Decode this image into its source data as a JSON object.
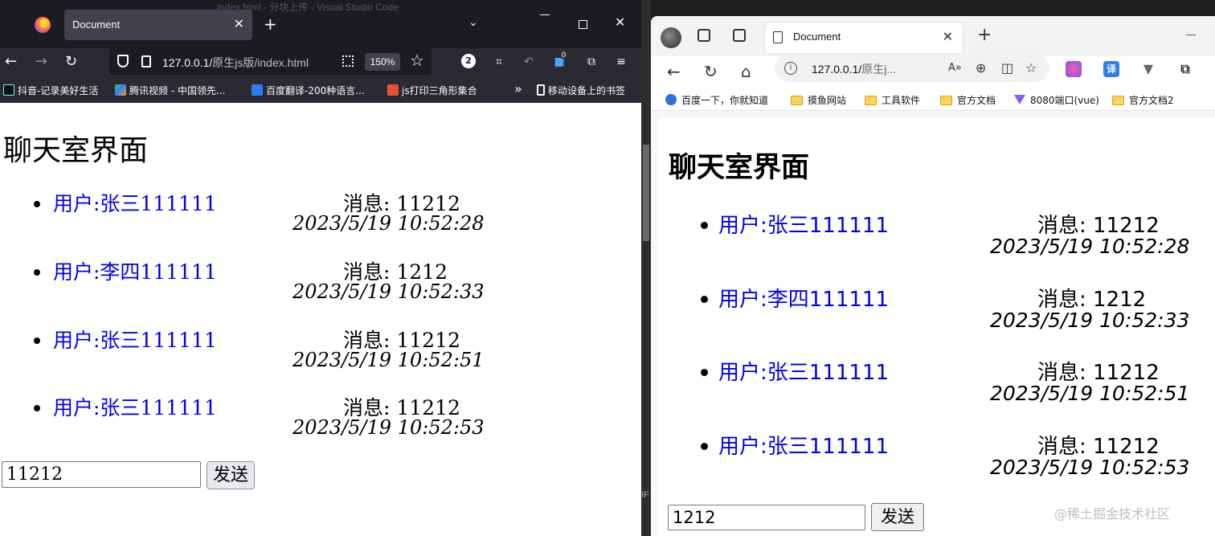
{
  "left_browser": {
    "background_title": "index.html - 分块上传 - Visual Studio Code",
    "tab_title": "Document",
    "url_host": "127.0.0.1/",
    "url_path": "原生js版/index.html",
    "zoom": "150%",
    "ext_badge_count": "2",
    "ext_badge_zero": "0",
    "bookmarks": [
      "抖音-记录美好生活",
      "腾讯视频 - 中国领先...",
      "百度翻译-200种语言...",
      "js打印三角形集合"
    ],
    "bookmark_more": "»",
    "mobile_bookmarks": "移动设备上的书签",
    "page": {
      "heading": "聊天室界面",
      "messages": [
        {
          "user": "用户:张三111111",
          "text": "消息: 11212",
          "time": "2023/5/19 10:52:28"
        },
        {
          "user": "用户:李四111111",
          "text": "消息: 1212",
          "time": "2023/5/19 10:52:33"
        },
        {
          "user": "用户:张三111111",
          "text": "消息: 11212",
          "time": "2023/5/19 10:52:51"
        },
        {
          "user": "用户:张三111111",
          "text": "消息: 11212",
          "time": "2023/5/19 10:52:53"
        }
      ],
      "input_value": "11212",
      "send_label": "发送"
    }
  },
  "divider": {
    "mini_label": "IF"
  },
  "right_browser": {
    "tab_title": "Document",
    "url_host": "127.0.0.1/",
    "url_path": "原生j...",
    "bookmarks": [
      "百度一下，你就知道",
      "摸鱼网站",
      "工具软件",
      "官方文档",
      "8080端口(vue)",
      "官方文档2"
    ],
    "ext_translate_label": "译",
    "page": {
      "heading": "聊天室界面",
      "messages": [
        {
          "user": "用户:张三111111",
          "text": "消息: 11212",
          "time": "2023/5/19 10:52:28"
        },
        {
          "user": "用户:李四111111",
          "text": "消息: 1212",
          "time": "2023/5/19 10:52:33"
        },
        {
          "user": "用户:张三111111",
          "text": "消息: 11212",
          "time": "2023/5/19 10:52:51"
        },
        {
          "user": "用户:张三111111",
          "text": "消息: 11212",
          "time": "2023/5/19 10:52:53"
        }
      ],
      "input_value": "1212",
      "send_label": "发送"
    },
    "watermark": "@稀土掘金技术社区"
  },
  "colors": {
    "link": "#0000ee",
    "firefox_chrome": "#1c1b22",
    "edge_chrome": "#f3f3f3"
  }
}
